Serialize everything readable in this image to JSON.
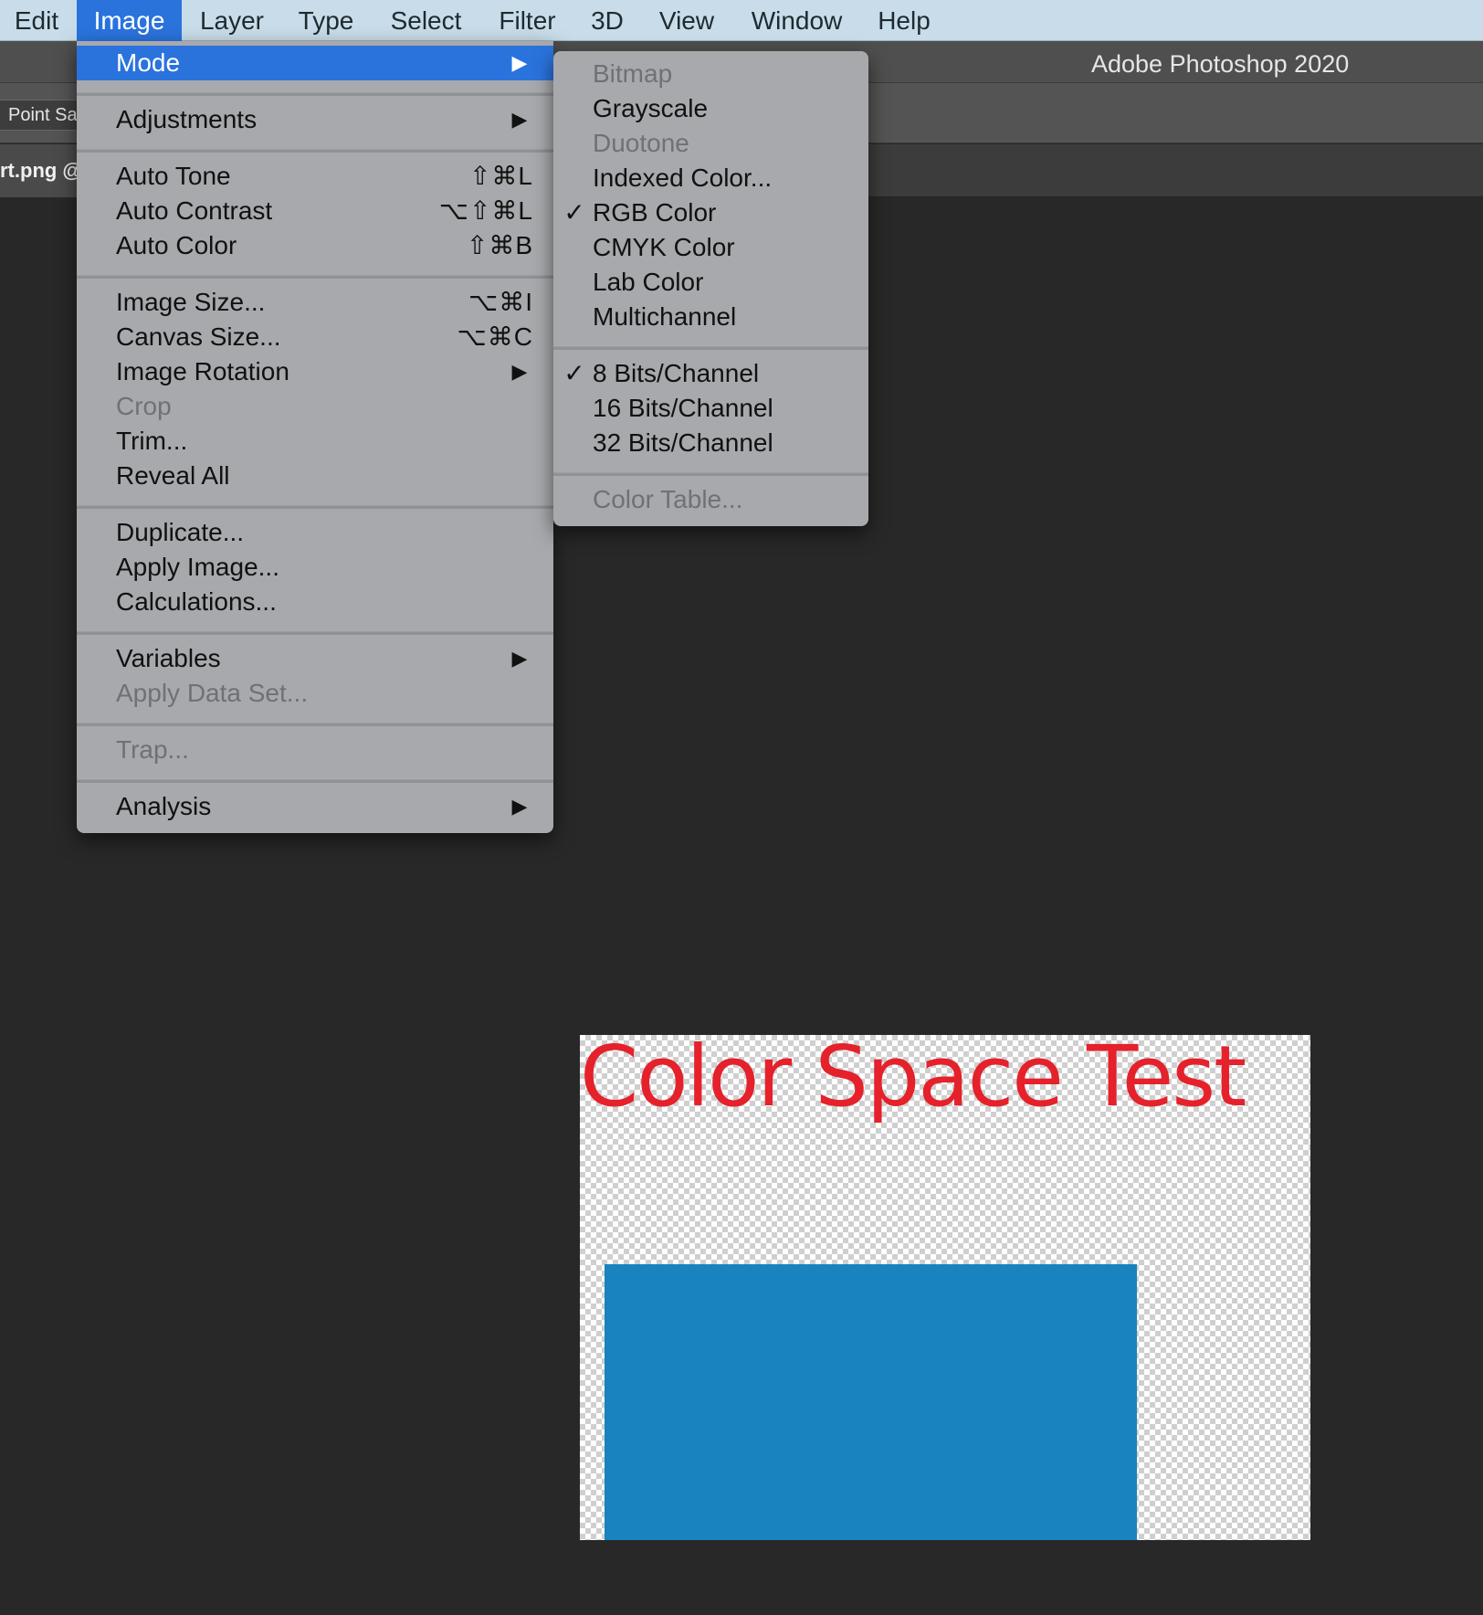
{
  "menubar": {
    "items": [
      {
        "label": "Edit"
      },
      {
        "label": "Image",
        "active": true
      },
      {
        "label": "Layer"
      },
      {
        "label": "Type"
      },
      {
        "label": "Select"
      },
      {
        "label": "Filter"
      },
      {
        "label": "3D"
      },
      {
        "label": "View"
      },
      {
        "label": "Window"
      },
      {
        "label": "Help"
      }
    ]
  },
  "app": {
    "title": "Adobe Photoshop 2020",
    "options_bar": {
      "sample_size": "Point Sample"
    },
    "document_tab": "rt.png @"
  },
  "image_menu": {
    "mode": "Mode",
    "adjustments": "Adjustments",
    "auto_tone": {
      "label": "Auto Tone",
      "shortcut": "⇧⌘L"
    },
    "auto_contrast": {
      "label": "Auto Contrast",
      "shortcut": "⌥⇧⌘L"
    },
    "auto_color": {
      "label": "Auto Color",
      "shortcut": "⇧⌘B"
    },
    "image_size": {
      "label": "Image Size...",
      "shortcut": "⌥⌘I"
    },
    "canvas_size": {
      "label": "Canvas Size...",
      "shortcut": "⌥⌘C"
    },
    "image_rotation": "Image Rotation",
    "crop": "Crop",
    "trim": "Trim...",
    "reveal_all": "Reveal All",
    "duplicate": "Duplicate...",
    "apply_image": "Apply Image...",
    "calculations": "Calculations...",
    "variables": "Variables",
    "apply_data_set": "Apply Data Set...",
    "trap": "Trap...",
    "analysis": "Analysis",
    "submenu_arrow": "▶"
  },
  "mode_submenu": {
    "check_glyph": "✓",
    "bitmap": "Bitmap",
    "grayscale": "Grayscale",
    "duotone": "Duotone",
    "indexed_color": "Indexed Color...",
    "rgb_color": "RGB Color",
    "cmyk_color": "CMYK Color",
    "lab_color": "Lab Color",
    "multichannel": "Multichannel",
    "bits_8": "8 Bits/Channel",
    "bits_16": "16 Bits/Channel",
    "bits_32": "32 Bits/Channel",
    "color_table": "Color Table...",
    "selected_mode": "RGB Color",
    "selected_depth": "8 Bits/Channel"
  },
  "canvas": {
    "text": "Color Space Test",
    "text_color": "#e5212b",
    "rect_color": "#1883be"
  }
}
